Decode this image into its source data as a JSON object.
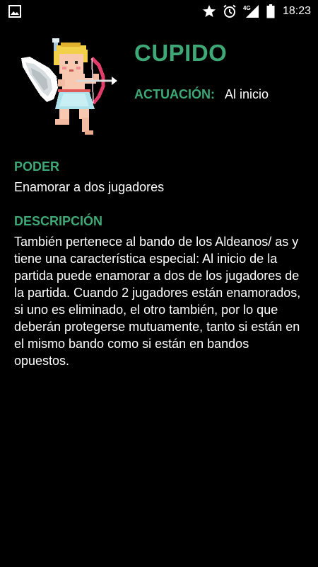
{
  "status_bar": {
    "time": "18:23",
    "network": "4G",
    "icons": [
      "image-icon",
      "star-icon",
      "alarm-icon",
      "signal-icon",
      "battery-icon"
    ]
  },
  "card": {
    "title": "CUPIDO",
    "actuacion_label": "ACTUACIÓN:",
    "actuacion_value": "Al inicio",
    "image_icon": "cupid-sprite-icon"
  },
  "poder": {
    "label": "PODER",
    "text": "Enamorar a dos jugadores"
  },
  "descripcion": {
    "label": "DESCRIPCIÓN",
    "text": "También pertenece al bando de los Aldeanos/ as y tiene una característica especial: Al inicio de la partida puede enamorar a dos de los jugadores de la partida. Cuando 2 jugadores están enamorados, si uno es eliminado, el otro también, por lo que deberán protegerse mutuamente, tanto si están en el mismo bando como si están en bandos opuestos."
  },
  "colors": {
    "accent": "#3fa877",
    "background": "#000000",
    "text": "#ffffff"
  }
}
